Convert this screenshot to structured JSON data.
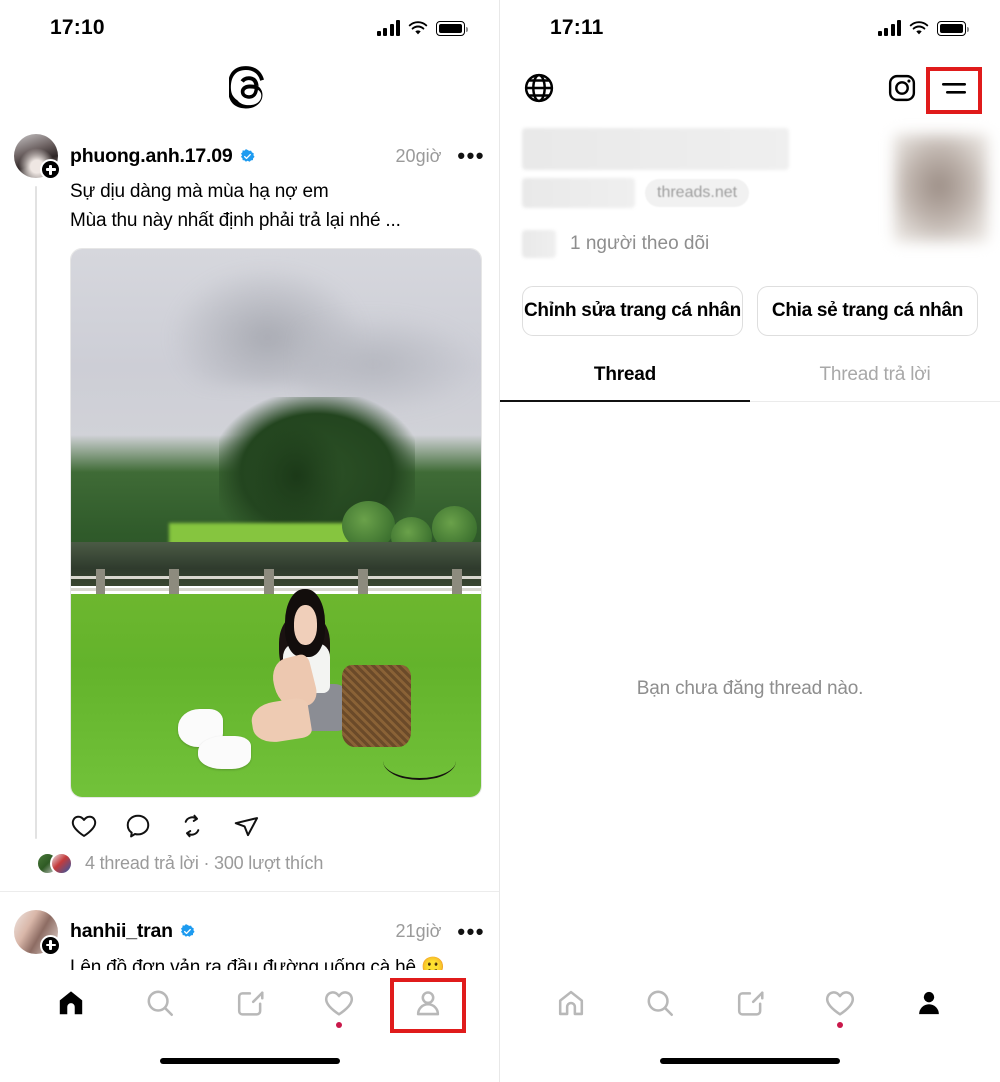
{
  "left_screen": {
    "status": {
      "time": "17:10",
      "icons": [
        "signal-icon",
        "wifi-icon",
        "battery-icon"
      ]
    },
    "header": {
      "logo": "threads-logo"
    },
    "posts": [
      {
        "username": "phuong.anh.17.09",
        "verified": true,
        "timestamp": "20giờ",
        "more": "•••",
        "text_line1": "Sự dịu dàng mà mùa hạ nợ em",
        "text_line2": "Mùa thu này nhất định phải trả lại nhé ...",
        "actions": [
          "like-icon",
          "comment-icon",
          "repost-icon",
          "share-icon"
        ],
        "stats": "4 thread trả lời · 300 lượt thích"
      },
      {
        "username": "hanhii_tran",
        "verified": true,
        "timestamp": "21giờ",
        "more": "•••",
        "text_line1": "Lên đồ đơn vản ra đầu đường uống cà hê 🙂"
      }
    ],
    "tabbar": {
      "items": [
        {
          "name": "home",
          "icon": "home-icon",
          "active": true,
          "badge": false,
          "highlight": false
        },
        {
          "name": "search",
          "icon": "search-icon",
          "active": false,
          "badge": false,
          "highlight": false
        },
        {
          "name": "compose",
          "icon": "compose-icon",
          "active": false,
          "badge": false,
          "highlight": false
        },
        {
          "name": "activity",
          "icon": "heart-icon",
          "active": false,
          "badge": true,
          "highlight": false
        },
        {
          "name": "profile",
          "icon": "person-icon",
          "active": false,
          "badge": false,
          "highlight": true
        }
      ]
    }
  },
  "right_screen": {
    "status": {
      "time": "17:11",
      "icons": [
        "signal-icon",
        "wifi-icon",
        "battery-icon"
      ]
    },
    "header": {
      "globe": "globe-icon",
      "instagram": "instagram-icon",
      "menu": "hamburger-menu-icon",
      "menu_highlighted": true
    },
    "profile": {
      "display_name_redacted": true,
      "handle_redacted": true,
      "domain_chip": "threads.net",
      "followers_count_redacted": true,
      "followers_label": "1 người theo dõi",
      "avatar_blurred": true
    },
    "buttons": {
      "edit_profile": "Chỉnh sửa trang cá nhân",
      "share_profile": "Chia sẻ trang cá nhân"
    },
    "tabs": [
      {
        "label": "Thread",
        "active": true
      },
      {
        "label": "Thread trả lời",
        "active": false
      }
    ],
    "empty_state": "Bạn chưa đăng thread nào.",
    "tabbar": {
      "items": [
        {
          "name": "home",
          "icon": "home-icon",
          "active": false,
          "badge": false,
          "highlight": false
        },
        {
          "name": "search",
          "icon": "search-icon",
          "active": false,
          "badge": false,
          "highlight": false
        },
        {
          "name": "compose",
          "icon": "compose-icon",
          "active": false,
          "badge": false,
          "highlight": false
        },
        {
          "name": "activity",
          "icon": "heart-icon",
          "active": false,
          "badge": true,
          "highlight": false
        },
        {
          "name": "profile",
          "icon": "person-icon",
          "active": true,
          "badge": false,
          "highlight": false
        }
      ]
    }
  },
  "colors": {
    "highlight_red": "#e01b1b",
    "verified_blue": "#1d9bf0",
    "badge_red": "#c9184a",
    "muted_text": "#8e8e8e"
  }
}
